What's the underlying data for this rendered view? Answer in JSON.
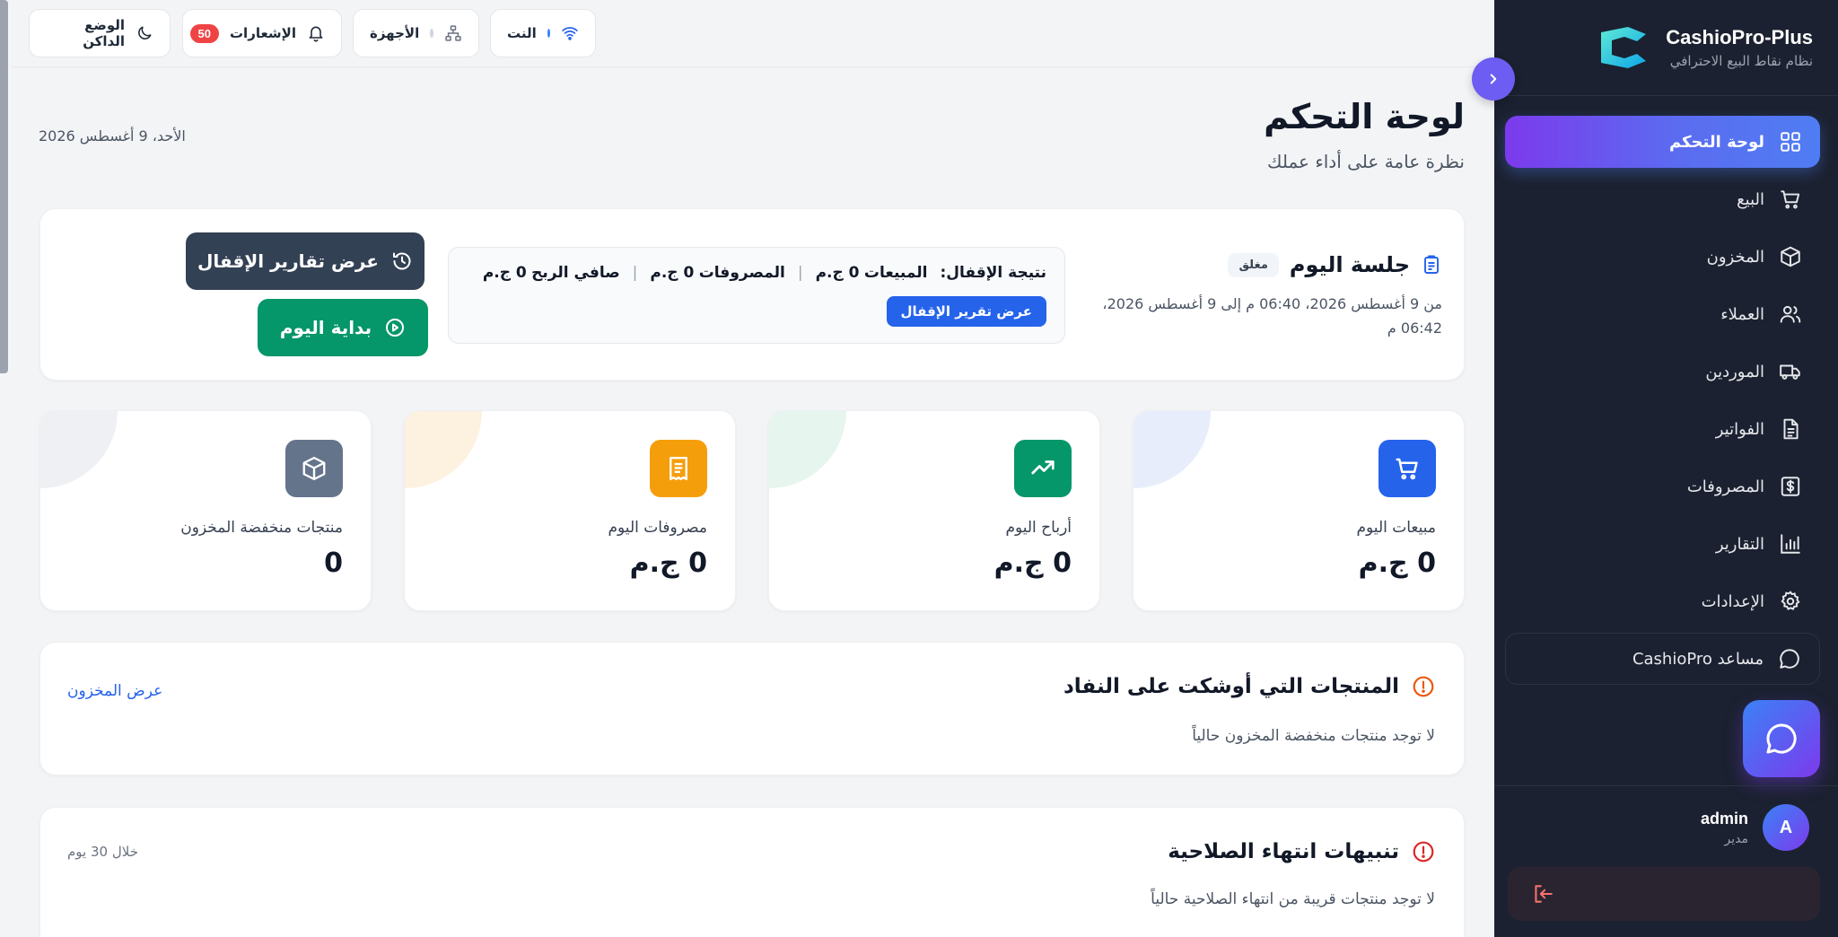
{
  "sidebar": {
    "brand_name": "CashioPro-Plus",
    "brand_subtitle": "نظام نقاط البيع الاحترافي",
    "items": [
      {
        "label": "لوحة التحكم",
        "icon": "grid-icon",
        "active": true
      },
      {
        "label": "البيع",
        "icon": "cart-icon"
      },
      {
        "label": "المخزون",
        "icon": "box-icon"
      },
      {
        "label": "العملاء",
        "icon": "users-icon"
      },
      {
        "label": "الموردين",
        "icon": "truck-icon"
      },
      {
        "label": "الفواتير",
        "icon": "document-icon"
      },
      {
        "label": "المصروفات",
        "icon": "dollar-icon"
      },
      {
        "label": "التقارير",
        "icon": "chart-icon"
      },
      {
        "label": "الإعدادات",
        "icon": "gear-icon"
      },
      {
        "label": "مساعد CashioPro",
        "icon": "chat-icon"
      }
    ],
    "user": {
      "initial": "A",
      "name": "admin",
      "role": "مدير"
    }
  },
  "topbar": {
    "dark_mode_label": "الوضع الداكن",
    "notifications_label": "الإشعارات",
    "notifications_count": "50",
    "devices_label": "الأجهزة",
    "net_label": "النت"
  },
  "header": {
    "title": "لوحة التحكم",
    "subtitle": "نظرة عامة على أداء عملك",
    "date": "الأحد، 9 أغسطس 2026"
  },
  "session": {
    "title": "جلسة اليوم",
    "status": "مغلق",
    "range": "من 9 أغسطس 2026، 06:40 م إلى 9 أغسطس 2026، 06:42 م",
    "result_label": "نتيجة الإقفال:",
    "sales_label": "المبيعات",
    "sales_value": "0 ج.م",
    "expenses_label": "المصروفات",
    "expenses_value": "0 ج.م",
    "profit_label": "صافي الربح",
    "profit_value": "0 ج.م",
    "report_button": "عرض تقرير الإقفال",
    "reports_button": "عرض تقارير الإقفال",
    "start_day_button": "بداية اليوم"
  },
  "stats": [
    {
      "label": "مبيعات اليوم",
      "value": "0 ج.م",
      "icon": "cart-icon",
      "color": "#2563eb",
      "tint": "#e8edfb"
    },
    {
      "label": "أرباح اليوم",
      "value": "0 ج.م",
      "icon": "trending-up-icon",
      "color": "#059669",
      "tint": "#e6f5ee"
    },
    {
      "label": "مصروفات اليوم",
      "value": "0 ج.م",
      "icon": "receipt-icon",
      "color": "#f59e0b",
      "tint": "#fdf1e0"
    },
    {
      "label": "منتجات منخفضة المخزون",
      "value": "0",
      "icon": "box-icon",
      "color": "#64748b",
      "tint": "#eef0f3"
    }
  ],
  "low_stock": {
    "title": "المنتجات التي أوشكت على النفاد",
    "empty": "لا توجد منتجات منخفضة المخزون حالياً",
    "link": "عرض المخزون"
  },
  "expiry": {
    "title": "تنبيهات انتهاء الصلاحية",
    "empty": "لا توجد منتجات قريبة من انتهاء الصلاحية حالياً",
    "period": "خلال 30 يوم"
  }
}
